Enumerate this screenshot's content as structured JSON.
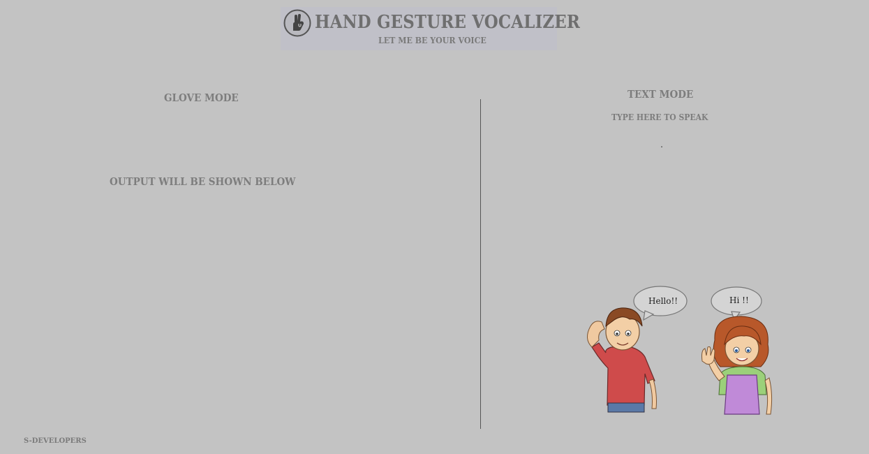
{
  "header": {
    "title": "HAND GESTURE VOCALIZER",
    "subtitle": "LET ME BE YOUR VOICE",
    "logo_icon": "hand-gesture-icon"
  },
  "glove_panel": {
    "heading": "GLOVE MODE",
    "output_label": "OUTPUT WILL BE SHOWN BELOW"
  },
  "text_panel": {
    "heading": "TEXT MODE",
    "input_label": "TYPE HERE TO SPEAK",
    "input_value": "."
  },
  "illustration": {
    "boy_speech": "Hello!!",
    "girl_speech": "Hi !!"
  },
  "footer": {
    "credit": "S-DEVELOPERS"
  },
  "colors": {
    "background": "#c3c3c3",
    "text": "#7b7b7b"
  }
}
